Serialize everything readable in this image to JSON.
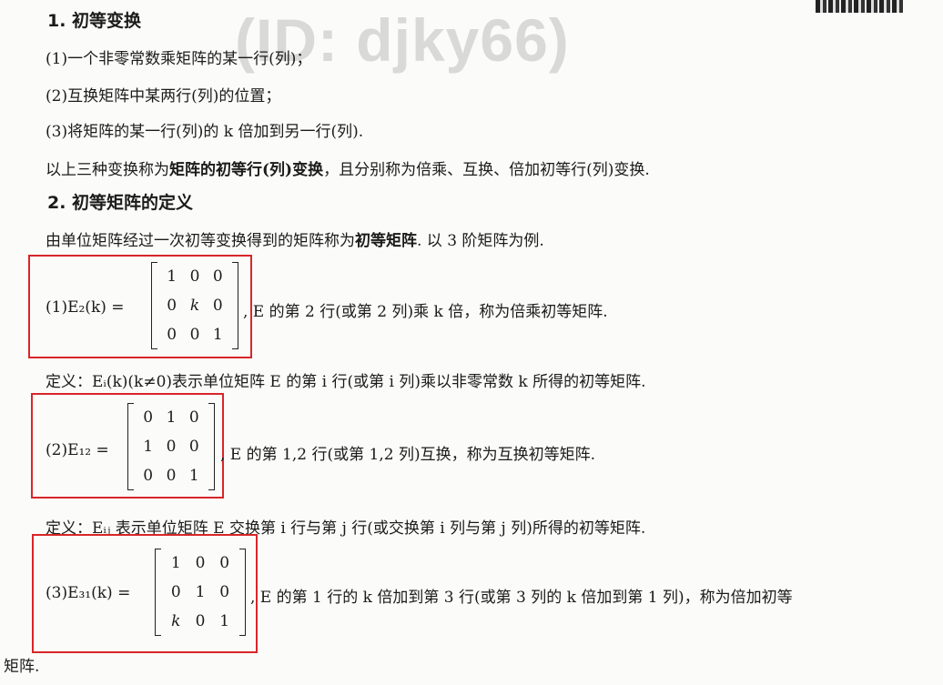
{
  "watermark": "(ID: djky66)",
  "section1": {
    "heading": "1. 初等变换",
    "items": [
      "(1)一个非零常数乘矩阵的某一行(列)；",
      "(2)互换矩阵中某两行(列)的位置；",
      "(3)将矩阵的某一行(列)的 k 倍加到另一行(列)."
    ],
    "summary_pre": "以上三种变换称为",
    "summary_bold": "矩阵的初等行(列)变换",
    "summary_post": "，且分别称为倍乘、互换、倍加初等行(列)变换."
  },
  "section2": {
    "heading": "2. 初等矩阵的定义",
    "intro_pre": "由单位矩阵经过一次初等变换得到的矩阵称为",
    "intro_bold": "初等矩阵",
    "intro_post": ". 以 3 阶矩阵为例."
  },
  "examples": [
    {
      "label": "(1)E₂(k) =",
      "matrix": [
        "1",
        "0",
        "0",
        "0",
        "k",
        "0",
        "0",
        "0",
        "1"
      ],
      "desc": ", E 的第 2 行(或第 2 列)乘 k 倍，称为倍乘初等矩阵.",
      "definition": "定义：Eᵢ(k)(k≠0)表示单位矩阵 E 的第 i 行(或第 i 列)乘以非零常数 k 所得的初等矩阵."
    },
    {
      "label": "(2)E₁₂ =",
      "matrix": [
        "0",
        "1",
        "0",
        "1",
        "0",
        "0",
        "0",
        "0",
        "1"
      ],
      "desc": ", E 的第 1,2 行(或第 1,2 列)互换，称为互换初等矩阵.",
      "definition": "定义：Eᵢⱼ 表示单位矩阵 E 交换第 i 行与第 j 行(或交换第 i 列与第 j 列)所得的初等矩阵."
    },
    {
      "label": "(3)E₃₁(k) =",
      "matrix": [
        "1",
        "0",
        "0",
        "0",
        "1",
        "0",
        "k",
        "0",
        "1"
      ],
      "desc": ", E 的第 1 行的 k 倍加到第 3 行(或第 3 列的 k 倍加到第 1 列)，称为倍加初等",
      "continuation": "矩阵."
    }
  ],
  "colors": {
    "highlight_box": "#d8262a",
    "watermark": "#d9d9d7"
  }
}
